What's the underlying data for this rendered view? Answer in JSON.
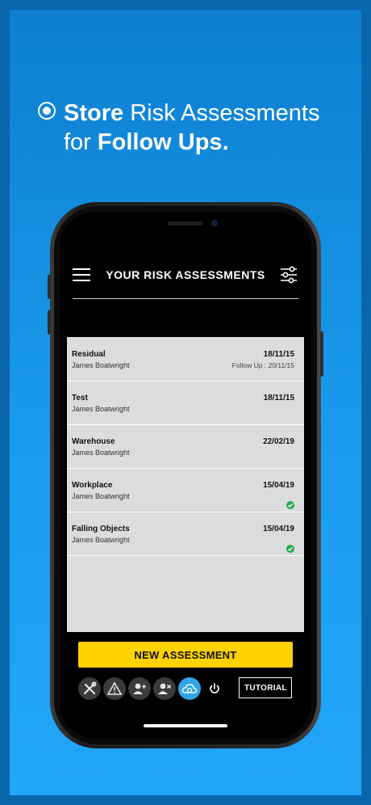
{
  "promo": {
    "line1_bold": "Store",
    "line1_rest": " Risk Assessments",
    "line2_pre": "for ",
    "line2_bold": "Follow Ups."
  },
  "header": {
    "title": "YOUR RISK ASSESSMENTS",
    "menu_icon": "hamburger-menu-icon",
    "filter_icon": "sliders-filter-icon"
  },
  "assessments": [
    {
      "title": "Residual",
      "author": "James Boatwright",
      "date": "18/11/15",
      "follow_up": "Follow Up : 20/11/15",
      "completed": false
    },
    {
      "title": "Test",
      "author": "James Boatwright",
      "date": "18/11/15",
      "follow_up": "",
      "completed": false
    },
    {
      "title": "Warehouse",
      "author": "James Boatwright",
      "date": "22/02/19",
      "follow_up": "",
      "completed": false
    },
    {
      "title": "Workplace",
      "author": "James Boatwright",
      "date": "15/04/19",
      "follow_up": "",
      "completed": true
    },
    {
      "title": "Falling Objects",
      "author": "James Boatwright",
      "date": "15/04/19",
      "follow_up": "",
      "completed": true
    }
  ],
  "actions": {
    "new_assessment": "NEW ASSESSMENT",
    "tutorial": "TUTORIAL",
    "toolbar_icons": [
      "tools-icon",
      "warning-icon",
      "add-user-icon",
      "remove-user-icon",
      "cloud-sync-icon",
      "power-icon"
    ]
  },
  "colors": {
    "background": "#1b9bef",
    "accent_yellow": "#ffd200",
    "check_green": "#2aa84a",
    "cloud_active": "#2fa6e8"
  }
}
